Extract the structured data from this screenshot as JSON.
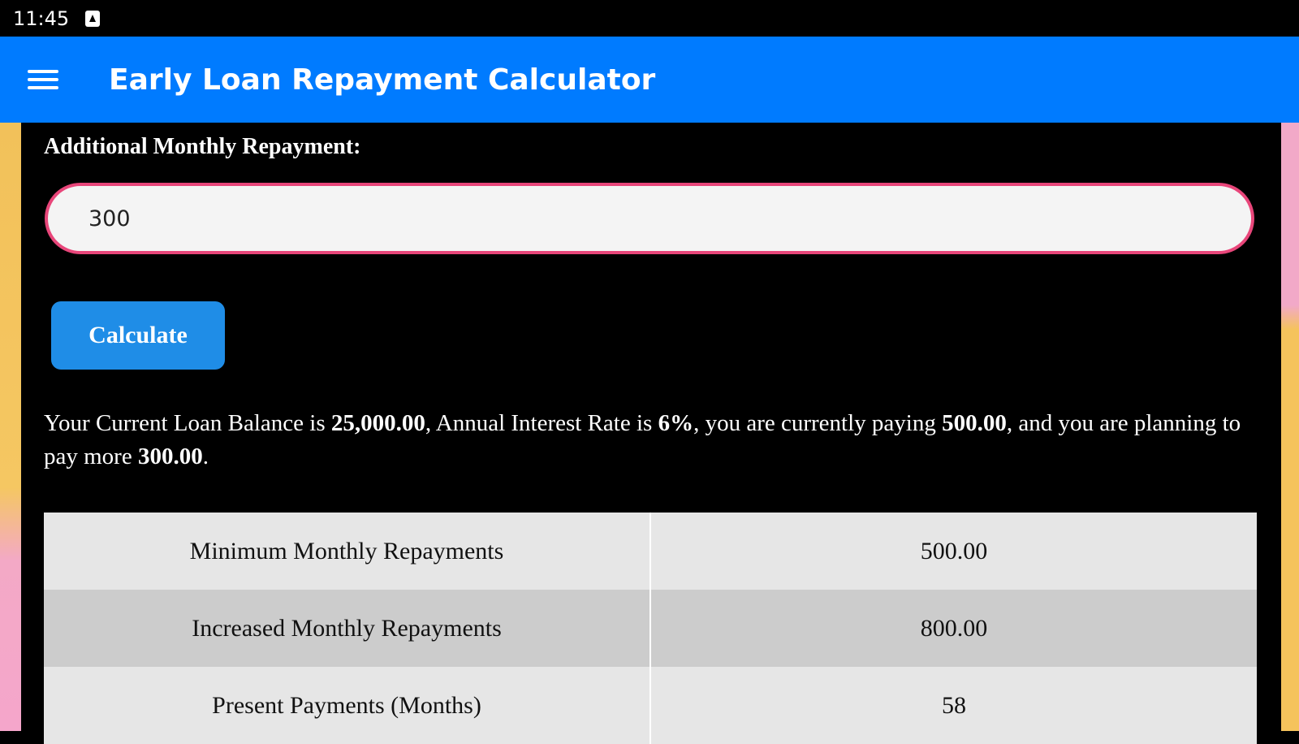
{
  "status_bar": {
    "time": "11:45"
  },
  "app_bar": {
    "title": "Early Loan Repayment Calculator"
  },
  "form": {
    "additional_label": "Additional Monthly Repayment:",
    "additional_value": "300",
    "calculate_label": "Calculate"
  },
  "summary": {
    "part1": "Your Current Loan Balance is ",
    "balance": "25,000.00",
    "part2": ", Annual Interest Rate is ",
    "rate": "6%",
    "part3": ", you are currently paying ",
    "current_payment": "500.00",
    "part4": ", and you are planning to pay more ",
    "extra_payment": "300.00",
    "part5": "."
  },
  "results": {
    "rows": [
      {
        "label": "Minimum Monthly Repayments",
        "value": "500.00"
      },
      {
        "label": "Increased Monthly Repayments",
        "value": "800.00"
      },
      {
        "label": "Present Payments (Months)",
        "value": "58"
      }
    ]
  },
  "colors": {
    "app_bar": "#007bff",
    "input_border": "#e8467a",
    "button": "#1f8de7"
  }
}
